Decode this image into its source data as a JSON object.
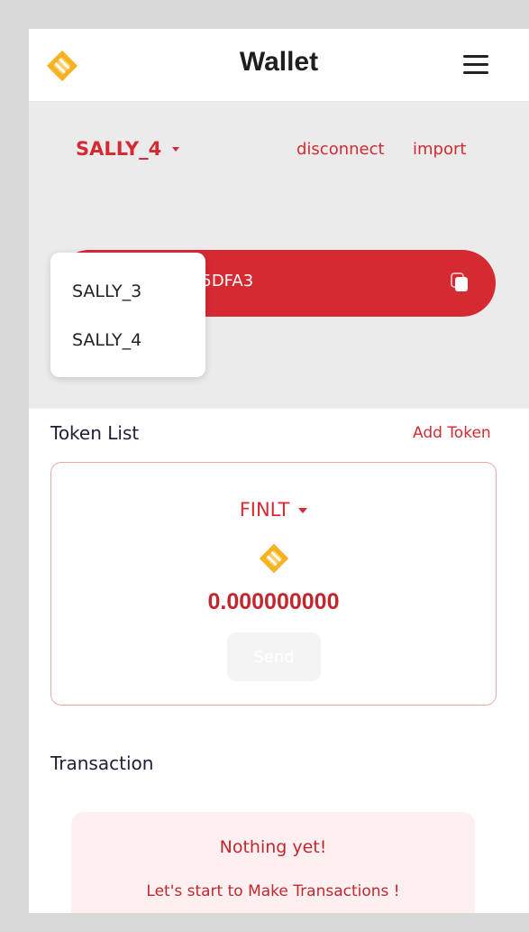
{
  "header": {
    "title": "Wallet",
    "logo_icon": "diamond-logo-icon",
    "menu_icon": "hamburger-menu-icon"
  },
  "account": {
    "selected": "SALLY_4",
    "disconnect_label": "disconnect",
    "import_label": "import",
    "address_visible": "E5DFA3",
    "copy_icon": "copy-icon",
    "dropdown_options": [
      "SALLY_3",
      "SALLY_4"
    ]
  },
  "token_list": {
    "title": "Token List",
    "add_label": "Add Token",
    "token": {
      "symbol": "FINLT",
      "balance": "0.000000000",
      "send_label": "Send"
    }
  },
  "transaction": {
    "title": "Transaction",
    "empty_title": "Nothing yet!",
    "empty_subtitle": "Let's start to Make Transactions !"
  },
  "colors": {
    "accent": "#d42a33",
    "logo": "#f5b324",
    "background": "#ebebeb"
  }
}
